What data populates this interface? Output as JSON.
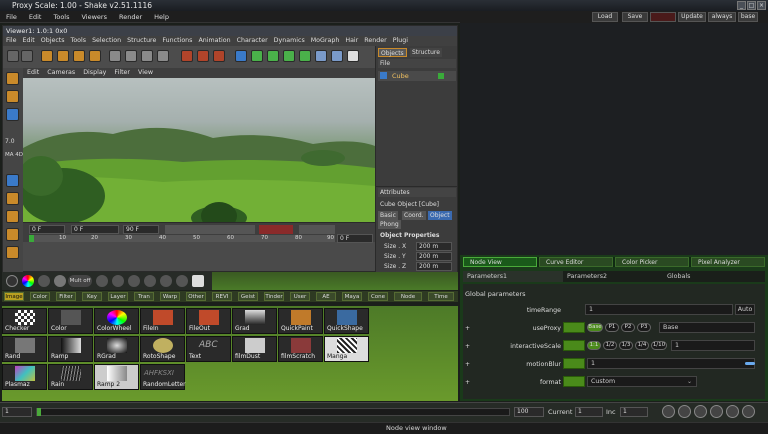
{
  "window": {
    "title": "Proxy Scale: 1.00 - Shake v2.51.1116"
  },
  "menubar": {
    "items": [
      "File",
      "Edit",
      "Tools",
      "Viewers",
      "Render",
      "Help"
    ]
  },
  "topbuttons": {
    "load": "Load",
    "save": "Save",
    "update": "Update",
    "always": "always",
    "base": "base"
  },
  "c4d": {
    "title": "Viewer1: 1.0:1  0x0",
    "menu": [
      "File",
      "Edit",
      "Objects",
      "Tools",
      "Selection",
      "Structure",
      "Functions",
      "Animation",
      "Character",
      "Dynamics",
      "MoGraph",
      "Hair",
      "Render",
      "Plugi"
    ],
    "view_menu": [
      "Edit",
      "Cameras",
      "Display",
      "Filter",
      "View"
    ],
    "left_labels": {
      "val1": "7.0",
      "val2": "MA 4D"
    },
    "timeline": {
      "start": "0 F",
      "current": "0 F",
      "end": "90 F",
      "cur2": "0 F",
      "ticks": [
        "0",
        "10",
        "20",
        "30",
        "40",
        "50",
        "60",
        "70",
        "80",
        "90"
      ]
    },
    "objects": {
      "tab1": "Objects",
      "tab2": "Structure",
      "menu": "File",
      "item": "Cube"
    },
    "attributes": {
      "title": "Attributes",
      "object": "Cube Object [Cube]",
      "tabs": [
        "Basic",
        "Coord.",
        "Object",
        "Phong"
      ],
      "section": "Object Properties",
      "rows": [
        {
          "label": "Size . X",
          "value": "200 m"
        },
        {
          "label": "Size . Y",
          "value": "200 m"
        },
        {
          "label": "Size . Z",
          "value": "200 m"
        }
      ]
    }
  },
  "shake": {
    "mult_off": "Mult off",
    "tabs": [
      "Image",
      "Color",
      "Filter",
      "Key",
      "Layer",
      "Tran",
      "Warp",
      "Other",
      "REVI",
      "Geist",
      "Tinder",
      "User",
      "AE",
      "Maya",
      "Cone",
      "Node",
      "Time"
    ],
    "tools": [
      [
        "Checker",
        "Color",
        "ColorWheel",
        "FileIn",
        "FileOut",
        "Grad",
        "QuickPaint",
        "QuickShape"
      ],
      [
        "Rand",
        "Ramp",
        "RGrad",
        "RotoShape",
        "Text",
        "filmDust",
        "filmScratch",
        "Manga"
      ],
      [
        "Plasmaz",
        "Rain",
        "Ramp 2",
        "RandomLetter"
      ]
    ],
    "text_glyph": "ABC",
    "letter_glyph": "AHFKSXI"
  },
  "right": {
    "tabs": [
      "Node View",
      "Curve Editor",
      "Color Picker",
      "Pixel Analyzer"
    ],
    "param_tabs": [
      "Parameters1",
      "Parameters2",
      "Globals"
    ],
    "section": "Global parameters",
    "time_range": {
      "label": "timeRange",
      "value": "1",
      "button": "Auto"
    },
    "use_proxy": {
      "label": "useProxy",
      "options": [
        "Base",
        "P1",
        "P2",
        "P3"
      ],
      "value": "Base"
    },
    "interactive_scale": {
      "label": "interactiveScale",
      "options": [
        "1:1",
        "1/2",
        "1/3",
        "1/4",
        "1/10"
      ],
      "value": "1"
    },
    "motion_blur": {
      "label": "motionBlur",
      "value": "1"
    },
    "format": {
      "label": "format",
      "value": "Custom"
    }
  },
  "bottom": {
    "start": "1",
    "end": "100",
    "current_label": "Current",
    "current": "1",
    "inc_label": "Inc",
    "inc": "1",
    "ticks": [
      "1",
      "",
      "",
      "",
      "",
      "",
      "",
      "",
      "",
      "",
      "100"
    ]
  },
  "status": {
    "text": "Node view window"
  }
}
